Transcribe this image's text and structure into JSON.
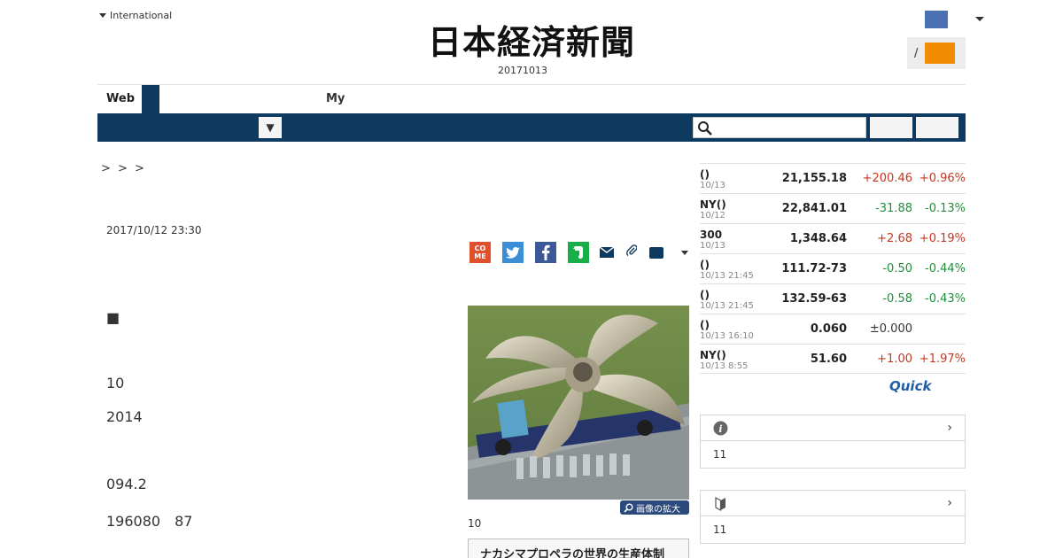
{
  "header": {
    "international_label": "International",
    "masthead": "日本経済新聞",
    "date": "20171013",
    "login_separator": "/"
  },
  "tabs": {
    "web_label": "Web",
    "my_label": "My"
  },
  "navbar": {
    "dropdown_glyph": "▼",
    "search_placeholder": "",
    "search_value": ""
  },
  "breadcrumb": "> > >",
  "article": {
    "date": "2017/10/12 23:30",
    "paragraphs": [
      "■",
      "10",
      "2014",
      "094.2",
      "196080　87"
    ],
    "photo_zoom_label": "画像の拡大",
    "photo_caption": "10",
    "related_title": "ナカシマプロペラの世界の生産体制"
  },
  "share": {
    "come_label": "CO ME"
  },
  "market": {
    "rows": [
      {
        "name": "()",
        "time": "10/13",
        "value": "21,155.18",
        "change": "+200.46",
        "pct": "+0.96%",
        "dir": "up"
      },
      {
        "name": "NY()",
        "time": "10/12",
        "value": "22,841.01",
        "change": "-31.88",
        "pct": "-0.13%",
        "dir": "down"
      },
      {
        "name": "300",
        "time": "10/13",
        "value": "1,348.64",
        "change": "+2.68",
        "pct": "+0.19%",
        "dir": "up"
      },
      {
        "name": "()",
        "time": "10/13 21:45",
        "value": "111.72-73",
        "change": "-0.50",
        "pct": "-0.44%",
        "dir": "down"
      },
      {
        "name": "()",
        "time": "10/13 21:45",
        "value": "132.59-63",
        "change": "-0.58",
        "pct": "-0.43%",
        "dir": "down"
      },
      {
        "name": "()",
        "time": "10/13 16:10",
        "value": "0.060",
        "change": "±0.000",
        "pct": "",
        "dir": "flat"
      },
      {
        "name": "NY()",
        "time": "10/13 8:55",
        "value": "51.60",
        "change": "+1.00",
        "pct": "+1.97%",
        "dir": "up"
      }
    ],
    "provider": "Quick"
  },
  "side_boxes": [
    {
      "icon": "info-icon",
      "body": "11"
    },
    {
      "icon": "beginner-mark-icon",
      "body": "11"
    }
  ],
  "colors": {
    "navy": "#0f3a5f",
    "accent_orange": "#f28c00",
    "up": "#c8361e",
    "down": "#1f8f3a"
  }
}
